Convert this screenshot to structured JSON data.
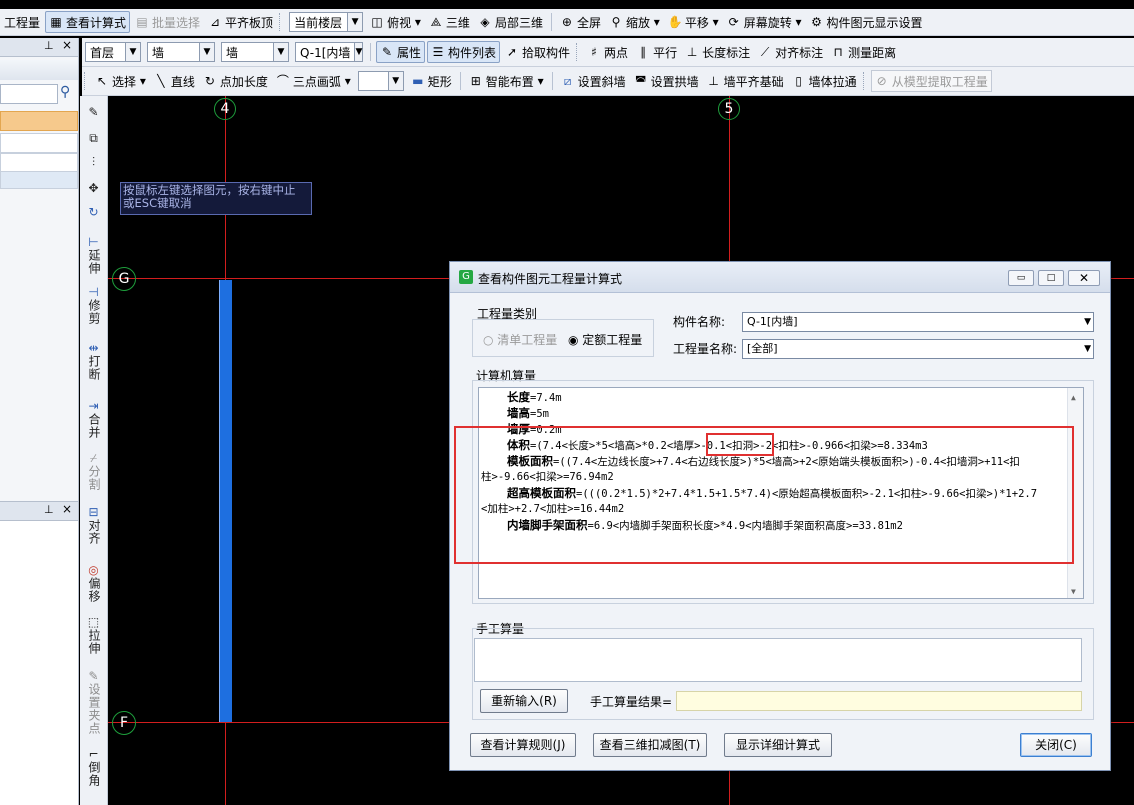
{
  "toolbar1": {
    "items": [
      "工程量",
      "查看计算式",
      "批量选择",
      "平齐板顶",
      "当前楼层",
      "俯视",
      "三维",
      "局部三维",
      "全屏",
      "缩放",
      "平移",
      "屏幕旋转",
      "构件图元显示设置"
    ]
  },
  "toolbar2": {
    "floor": "首层",
    "type1": "墙",
    "type2": "墙",
    "component": "Q-1[内墙",
    "items": [
      "属性",
      "构件列表",
      "拾取构件",
      "两点",
      "平行",
      "长度标注",
      "对齐标注",
      "测量距离"
    ]
  },
  "toolbar3": {
    "items": [
      "选择",
      "直线",
      "点加长度",
      "三点画弧",
      "矩形",
      "智能布置",
      "设置斜墙",
      "设置拱墙",
      "墙平齐基础",
      "墙体拉通",
      "从模型提取工程量"
    ]
  },
  "vtools": [
    "延伸",
    "修剪",
    "打断",
    "合并",
    "分割",
    "对齐",
    "偏移",
    "拉伸",
    "设置夹点",
    "倒角"
  ],
  "canvas": {
    "axis_labels": [
      "4",
      "5",
      "G",
      "F"
    ],
    "tooltip": [
      "按鼠标左键选择图元，按右键中止",
      "或ESC键取消"
    ]
  },
  "dialog": {
    "title": "查看构件图元工程量计算式",
    "category_label": "工程量类别",
    "radio1": "清单工程量",
    "radio2": "定额工程量",
    "name_label": "构件名称:",
    "name_value": "Q-1[内墙]",
    "qty_label": "工程量名称:",
    "qty_value": "[全部]",
    "calc_label": "计算机算量",
    "lines": [
      {
        "name": "长度",
        "expr": "=7.4m"
      },
      {
        "name": "墙高",
        "expr": "=5m"
      },
      {
        "name": "墙厚",
        "expr": "=0.2m"
      },
      {
        "name": "体积",
        "expr": "=(7.4<长度>*5<墙高>*0.2<墙厚>-0.1<扣洞>-2<扣柱>-0.966<扣梁>=8.334m3"
      },
      {
        "name": "模板面积",
        "expr": "=((7.4<左边线长度>+7.4<右边线长度>)*5<墙高>+2<原始端头模板面积>)-0.4<扣墙洞>+11<扣"
      },
      {
        "name": "",
        "expr": "柱>-9.66<扣梁>=76.94m2"
      },
      {
        "name": "超高模板面积",
        "expr": "=(((0.2*1.5)*2+7.4*1.5+1.5*7.4)<原始超高模板面积>-2.1<扣柱>-9.66<扣梁>)*1+2.7"
      },
      {
        "name": "",
        "expr": "<加柱>+2.7<加柱>=16.44m2"
      },
      {
        "name": "内墙脚手架面积",
        "expr": "=6.9<内墙脚手架面积长度>*4.9<内墙脚手架面积高度>=33.81m2"
      }
    ],
    "manual_label": "手工算量",
    "reinput": "重新输入(R)",
    "manual_result_label": "手工算量结果=",
    "btn_rule": "查看计算规则(J)",
    "btn_3d": "查看三维扣减图(T)",
    "btn_detail": "显示详细计算式",
    "btn_close": "关闭(C)"
  },
  "colors": {
    "accent": "#e03030",
    "wall": "#1e6fe0",
    "axis": "#d21e1e",
    "axis_circle": "#1e9e3c"
  }
}
